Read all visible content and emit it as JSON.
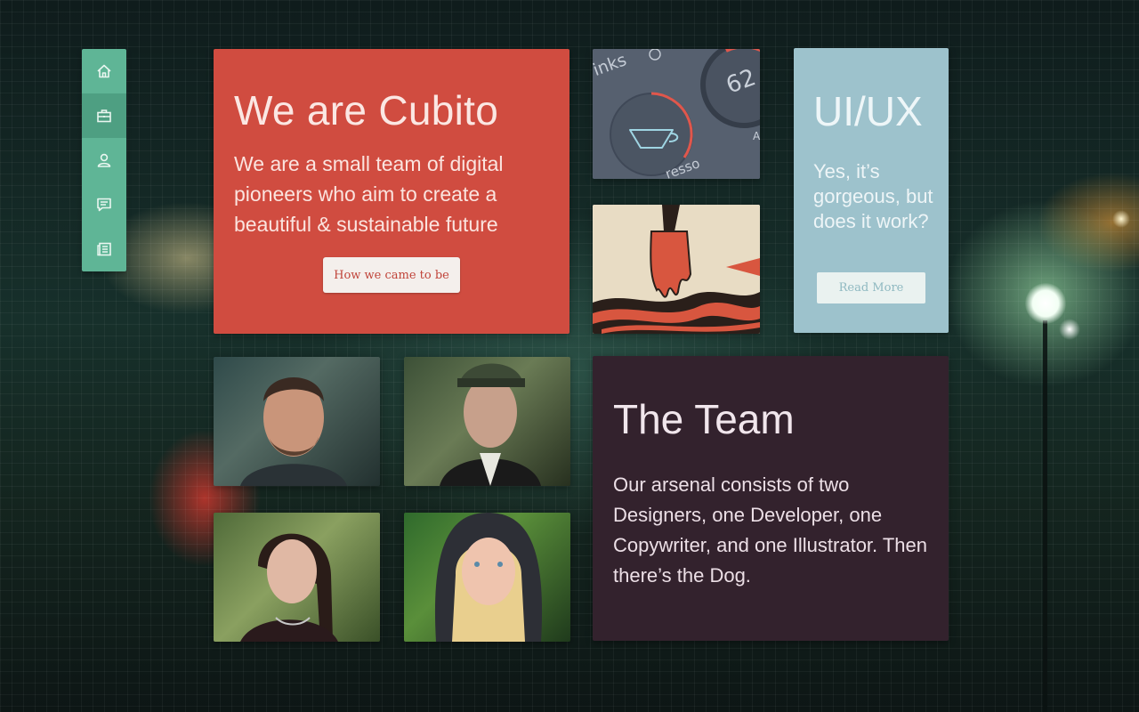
{
  "nav": {
    "items": [
      {
        "icon": "home-icon"
      },
      {
        "icon": "briefcase-icon"
      },
      {
        "icon": "user-icon"
      },
      {
        "icon": "chat-icon"
      },
      {
        "icon": "newspaper-icon"
      }
    ],
    "active_index": 1
  },
  "intro": {
    "title": "We are Cubito",
    "text": "We are a small team of digital pioneers who aim to create a beautiful & sustainable future",
    "button_label": "How we came to be"
  },
  "coffee_app": {
    "drinks_label": "rinks",
    "counter": "62",
    "counter_suffix": "A",
    "espresso_label": "resso"
  },
  "uiux": {
    "title": "UI/UX",
    "text": "Yes, it’s gorgeous, but does it work?",
    "button_label": "Read More"
  },
  "team": {
    "title": "The Team",
    "text": "Our arsenal consists of two Designers, one Developer, one Copywriter, and one Illustrator. Then there’s the Dog."
  },
  "colors": {
    "sidebar": "#5fb596",
    "intro": "#d04c40",
    "uiux": "#9dc2cc",
    "team": "#33222d"
  }
}
